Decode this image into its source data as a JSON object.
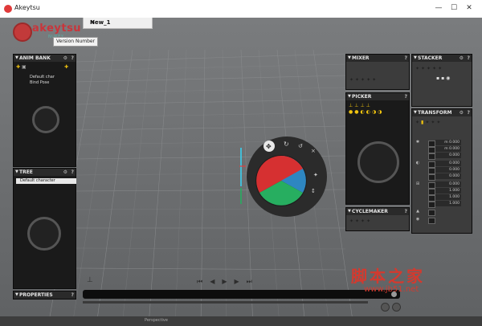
{
  "window": {
    "title": "Akeytsu",
    "min": "—",
    "max": "☐",
    "close": "✕"
  },
  "logo": {
    "name": "akeytsu",
    "sub": "NUKEY"
  },
  "tooltip": {
    "text": "Version Number"
  },
  "doc_tab": {
    "label": "New_1",
    "close": "✕"
  },
  "anim_bank": {
    "title": "ANIM BANK",
    "items": [
      {
        "label": "Default char"
      },
      {
        "label": "Bind Pose"
      }
    ]
  },
  "tree": {
    "title": "TREE",
    "items": [
      {
        "label": "Default character"
      }
    ]
  },
  "properties": {
    "title": "PROPERTIES"
  },
  "mixer": {
    "title": "MIXER"
  },
  "picker": {
    "title": "PICKER"
  },
  "cyclemaker": {
    "title": "CYCLEMAKER"
  },
  "stacker": {
    "title": "STACKER"
  },
  "transform": {
    "title": "TRANSFORM",
    "values": [
      "m 0.000",
      "m 0.000",
      "0.000",
      "0.000",
      "0.000",
      "0.000",
      "0.000",
      "1.000",
      "1.000",
      "1.000"
    ]
  },
  "statusbar": {
    "text": "Perspective"
  },
  "watermark": {
    "cn": "脚本之家",
    "url": "www.jb51.net"
  },
  "colors": {
    "accent_red": "#d0343a",
    "teal": "#4aa3a0",
    "yellow": "#f1c40f",
    "radial_red": "#d63031",
    "radial_green": "#27ae60",
    "radial_blue": "#2e86c1"
  },
  "icons": [
    "help-icon",
    "gear-icon",
    "plus-icon",
    "lock-icon",
    "play-icon",
    "rewind-icon",
    "forward-icon",
    "zoom-icon",
    "brain-icon",
    "film-reel-icon"
  ]
}
